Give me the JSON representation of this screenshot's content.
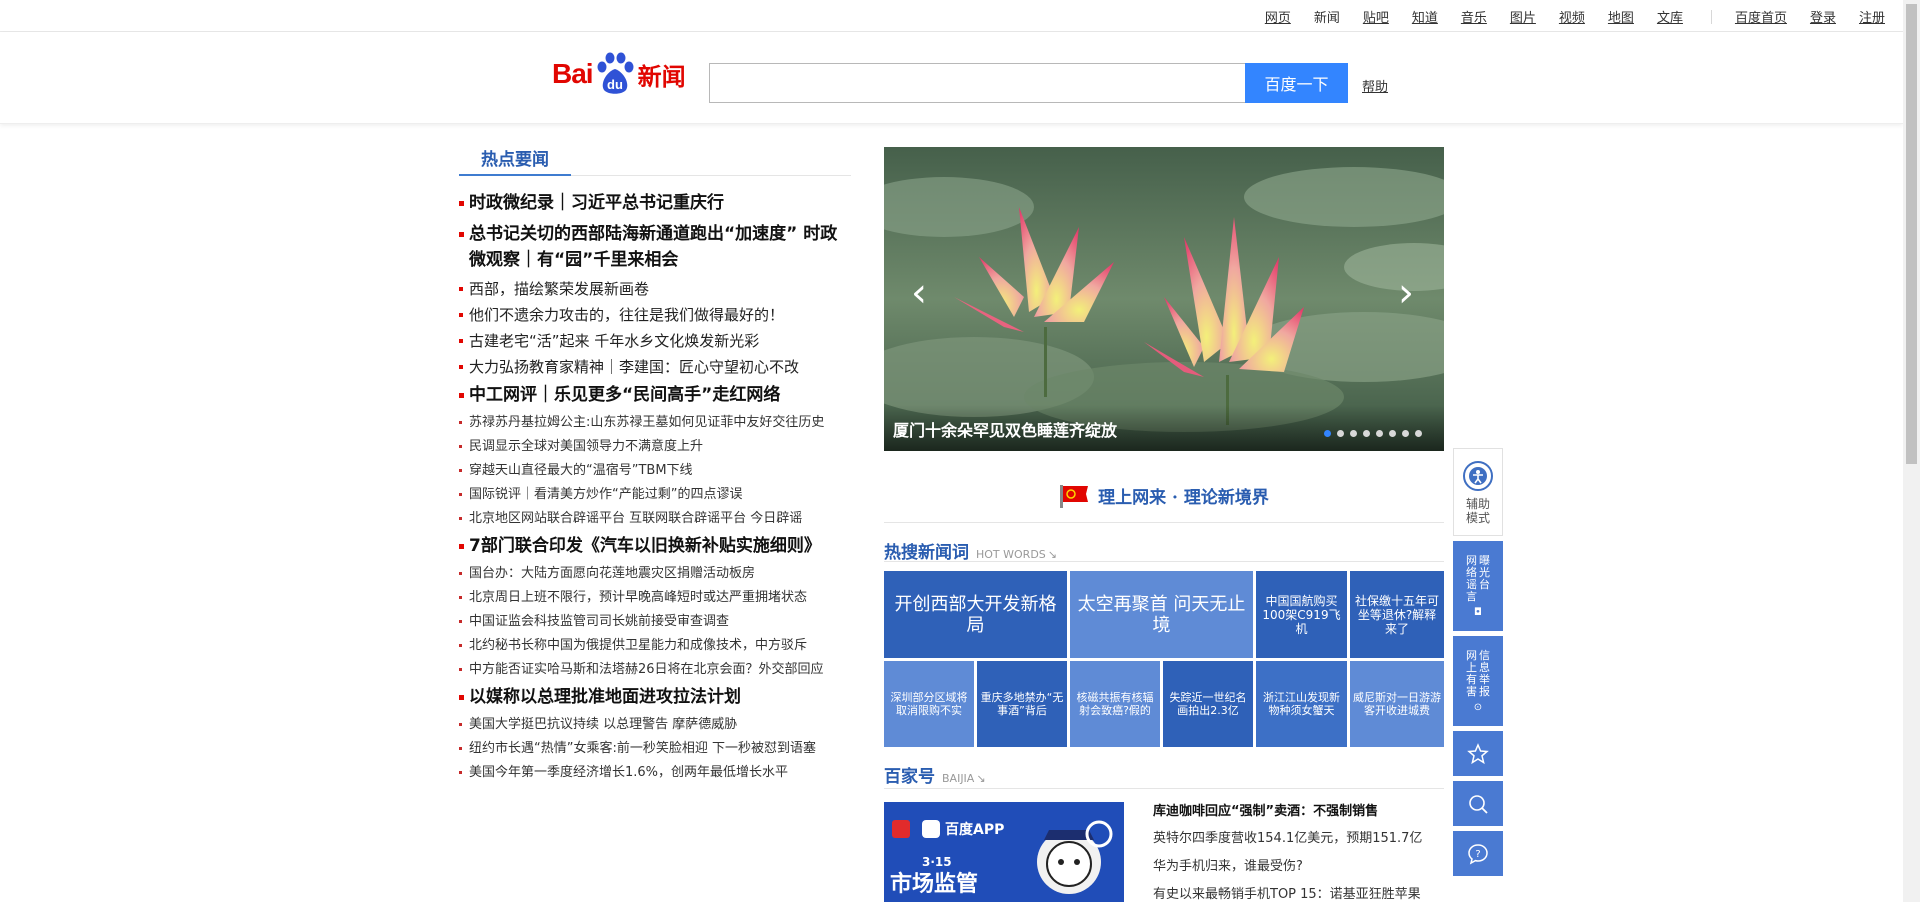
{
  "topnav": {
    "links": [
      "网页",
      "新闻",
      "贴吧",
      "知道",
      "音乐",
      "图片",
      "视频",
      "地图",
      "文库"
    ],
    "current": "新闻",
    "home": "百度首页",
    "login": "登录",
    "register": "注册"
  },
  "header": {
    "logo_bai": "Bai",
    "logo_du": "du",
    "logo_news": "新闻",
    "search_value": "",
    "search_button": "百度一下",
    "help": "帮助"
  },
  "hot": {
    "tab": "热点要闻",
    "items": [
      {
        "size": "big",
        "text": "时政微纪录｜习近平总书记重庆行"
      },
      {
        "size": "big",
        "text": "总书记关切的西部陆海新通道跑出“加速度” 时政微观察｜有“园”千里来相会"
      },
      {
        "size": "mid",
        "text": "西部，描绘繁荣发展新画卷"
      },
      {
        "size": "mid",
        "text": "他们不遗余力攻击的，往往是我们做得最好的！"
      },
      {
        "size": "mid",
        "text": "古建老宅“活”起来 千年水乡文化焕发新光彩"
      },
      {
        "size": "mid",
        "text": "大力弘扬教育家精神｜李建国：匠心守望初心不改"
      },
      {
        "size": "big",
        "text": "中工网评｜乐见更多“民间高手”走红网络"
      },
      {
        "size": "sm",
        "text": "苏禄苏丹基拉姆公主:山东苏禄王墓如何见证菲中友好交往历史"
      },
      {
        "size": "sm",
        "text": "民调显示全球对美国领导力不满意度上升"
      },
      {
        "size": "sm",
        "text": "穿越天山直径最大的“温宿号”TBM下线"
      },
      {
        "size": "sm",
        "text": "国际锐评｜看清美方炒作“产能过剩”的四点谬误"
      },
      {
        "size": "sm",
        "text": "北京地区网站联合辟谣平台 互联网联合辟谣平台 今日辟谣"
      },
      {
        "size": "big",
        "text": "7部门联合印发《汽车以旧换新补贴实施细则》"
      },
      {
        "size": "sm",
        "text": "国台办：大陆方面愿向花莲地震灾区捐赠活动板房"
      },
      {
        "size": "sm",
        "text": "北京周日上班不限行，预计早晚高峰短时或达严重拥堵状态"
      },
      {
        "size": "sm",
        "text": "中国证监会科技监管司司长姚前接受审查调查"
      },
      {
        "size": "sm",
        "text": "北约秘书长称中国为俄提供卫星能力和成像技术，中方驳斥"
      },
      {
        "size": "sm",
        "text": "中方能否证实哈马斯和法塔赫26日将在北京会面？外交部回应"
      },
      {
        "size": "big",
        "text": "以媒称以总理批准地面进攻拉法计划"
      },
      {
        "size": "sm",
        "text": "美国大学挺巴抗议持续 以总理警告 摩萨德威胁"
      },
      {
        "size": "sm",
        "text": "纽约市长遇“热情”女乘客:前一秒笑脸相迎 下一秒被怼到语塞"
      },
      {
        "size": "sm",
        "text": "美国今年第一季度经济增长1.6%，创两年最低增长水平"
      }
    ]
  },
  "carousel": {
    "caption": "厦门十余朵罕见双色睡莲齐绽放",
    "prev": "‹",
    "next": "›",
    "dots": 8,
    "active": 0
  },
  "theory": {
    "title": "理上网来 · 理论新境界"
  },
  "hotwords": {
    "title": "热搜新闻词",
    "en": "HOT WORDS",
    "cells": [
      "开创西部大开发新格局",
      "太空再聚首 问天无止境",
      "中国国航购买100架C919飞机",
      "社保缴十五年可坐等退休?解释来了",
      "深圳部分区域将取消限购不实",
      "重庆多地禁办“无事酒”背后",
      "核磁共振有核辐射会致癌?假的",
      "失踪近一世纪名画拍出2.3亿",
      "浙江江山发现新物种须女蟹天",
      "威尼斯对一日游游客开收进城费"
    ],
    "colors": {
      "dark": "#2f61b8",
      "light": "#5f8bd6",
      "mid": "#3d70c6"
    }
  },
  "baijia": {
    "title": "百家号",
    "en": "BAIJIA",
    "promo_app": "百度APP",
    "promo_date": "3·15",
    "promo_text": "市场监管",
    "items": [
      "库迪咖啡回应“强制”卖酒：不强制销售",
      "英特尔四季度营收154.1亿美元，预期151.7亿",
      "华为手机归来，谁最受伤?",
      "有史以来最畅销手机TOP 15：诺基亚狂胜苹果"
    ]
  },
  "tools": {
    "assist": "辅助模式",
    "report1_a": "曝光台",
    "report1_b": "网络谣言",
    "report2_a": "信息举报",
    "report2_b": "网上有害"
  }
}
